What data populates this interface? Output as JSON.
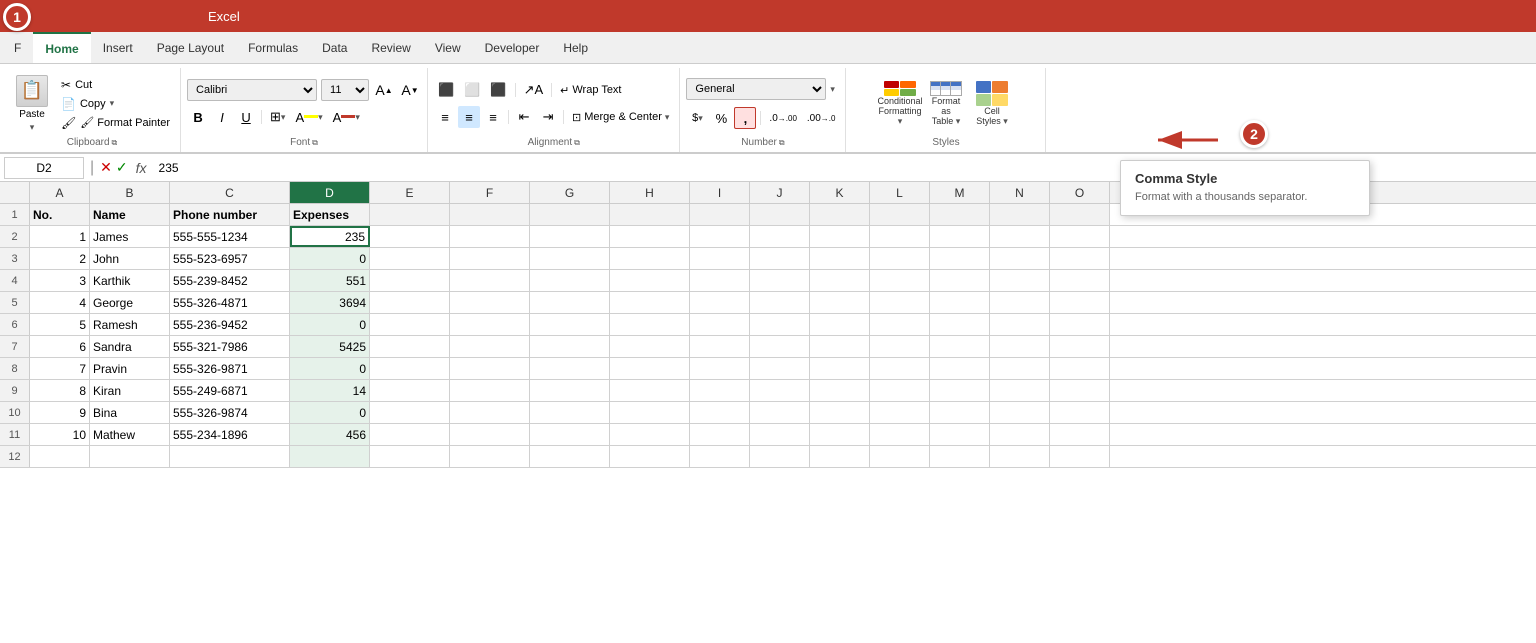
{
  "app": {
    "title": "Excel",
    "badge1": "1",
    "badge2": "2"
  },
  "tabs": [
    {
      "id": "file",
      "label": "F"
    },
    {
      "id": "home",
      "label": "Home",
      "active": true
    },
    {
      "id": "insert",
      "label": "Insert"
    },
    {
      "id": "page-layout",
      "label": "Page Layout"
    },
    {
      "id": "formulas",
      "label": "Formulas"
    },
    {
      "id": "data",
      "label": "Data"
    },
    {
      "id": "review",
      "label": "Review"
    },
    {
      "id": "view",
      "label": "View"
    },
    {
      "id": "developer",
      "label": "Developer"
    },
    {
      "id": "help",
      "label": "Help"
    }
  ],
  "ribbon": {
    "clipboard": {
      "label": "Clipboard",
      "paste": "Paste",
      "cut": "✂ Cut",
      "copy": "📋 Copy",
      "format_painter": "🖌 Format Painter"
    },
    "font": {
      "label": "Font",
      "font_name": "Calibri",
      "font_size": "11",
      "bold": "B",
      "italic": "I",
      "underline": "U",
      "borders": "⊞",
      "fill_color": "A",
      "font_color": "A"
    },
    "alignment": {
      "label": "Alignment",
      "wrap_text": "Wrap Text",
      "merge_center": "Merge & Center"
    },
    "number": {
      "label": "Number",
      "format": "General",
      "accounting": "$",
      "percent": "%",
      "comma": ",",
      "increase_decimal": ".0→.00",
      "decrease_decimal": ".00→.0"
    },
    "styles": {
      "label": "Styles",
      "conditional_formatting": "Conditional Formatting",
      "format_as_table": "Format as Table",
      "cell_styles": "Cell Styles"
    }
  },
  "formula_bar": {
    "cell_ref": "D2",
    "formula": "235",
    "fx_label": "fx"
  },
  "columns": [
    "A",
    "B",
    "C",
    "D",
    "E",
    "F",
    "G",
    "H",
    "I",
    "J",
    "K",
    "L",
    "M",
    "N",
    "O"
  ],
  "rows": [
    {
      "num": "1",
      "cells": [
        "No.",
        "Name",
        "Phone number",
        "Expenses",
        "",
        "",
        "",
        "",
        "",
        "",
        "",
        "",
        "",
        "",
        ""
      ]
    },
    {
      "num": "2",
      "cells": [
        "1",
        "James",
        "555-555-1234",
        "235",
        "",
        "",
        "",
        "",
        "",
        "",
        "",
        "",
        "",
        "",
        ""
      ]
    },
    {
      "num": "3",
      "cells": [
        "2",
        "John",
        "555-523-6957",
        "0",
        "",
        "",
        "",
        "",
        "",
        "",
        "",
        "",
        "",
        "",
        ""
      ]
    },
    {
      "num": "4",
      "cells": [
        "3",
        "Karthik",
        "555-239-8452",
        "551",
        "",
        "",
        "",
        "",
        "",
        "",
        "",
        "",
        "",
        "",
        ""
      ]
    },
    {
      "num": "5",
      "cells": [
        "4",
        "George",
        "555-326-4871",
        "3694",
        "",
        "",
        "",
        "",
        "",
        "",
        "",
        "",
        "",
        "",
        ""
      ]
    },
    {
      "num": "6",
      "cells": [
        "5",
        "Ramesh",
        "555-236-9452",
        "0",
        "",
        "",
        "",
        "",
        "",
        "",
        "",
        "",
        "",
        "",
        ""
      ]
    },
    {
      "num": "7",
      "cells": [
        "6",
        "Sandra",
        "555-321-7986",
        "5425",
        "",
        "",
        "",
        "",
        "",
        "",
        "",
        "",
        "",
        "",
        ""
      ]
    },
    {
      "num": "8",
      "cells": [
        "7",
        "Pravin",
        "555-326-9871",
        "0",
        "",
        "",
        "",
        "",
        "",
        "",
        "",
        "",
        "",
        "",
        ""
      ]
    },
    {
      "num": "9",
      "cells": [
        "8",
        "Kiran",
        "555-249-6871",
        "14",
        "",
        "",
        "",
        "",
        "",
        "",
        "",
        "",
        "",
        "",
        ""
      ]
    },
    {
      "num": "10",
      "cells": [
        "9",
        "Bina",
        "555-326-9874",
        "0",
        "",
        "",
        "",
        "",
        "",
        "",
        "",
        "",
        "",
        "",
        ""
      ]
    },
    {
      "num": "11",
      "cells": [
        "10",
        "Mathew",
        "555-234-1896",
        "456",
        "",
        "",
        "",
        "",
        "",
        "",
        "",
        "",
        "",
        "",
        ""
      ]
    },
    {
      "num": "12",
      "cells": [
        "",
        "",
        "",
        "",
        "",
        "",
        "",
        "",
        "",
        "",
        "",
        "",
        "",
        "",
        ""
      ]
    }
  ],
  "tooltip": {
    "title": "Comma Style",
    "description": "Format with a thousands separator."
  }
}
